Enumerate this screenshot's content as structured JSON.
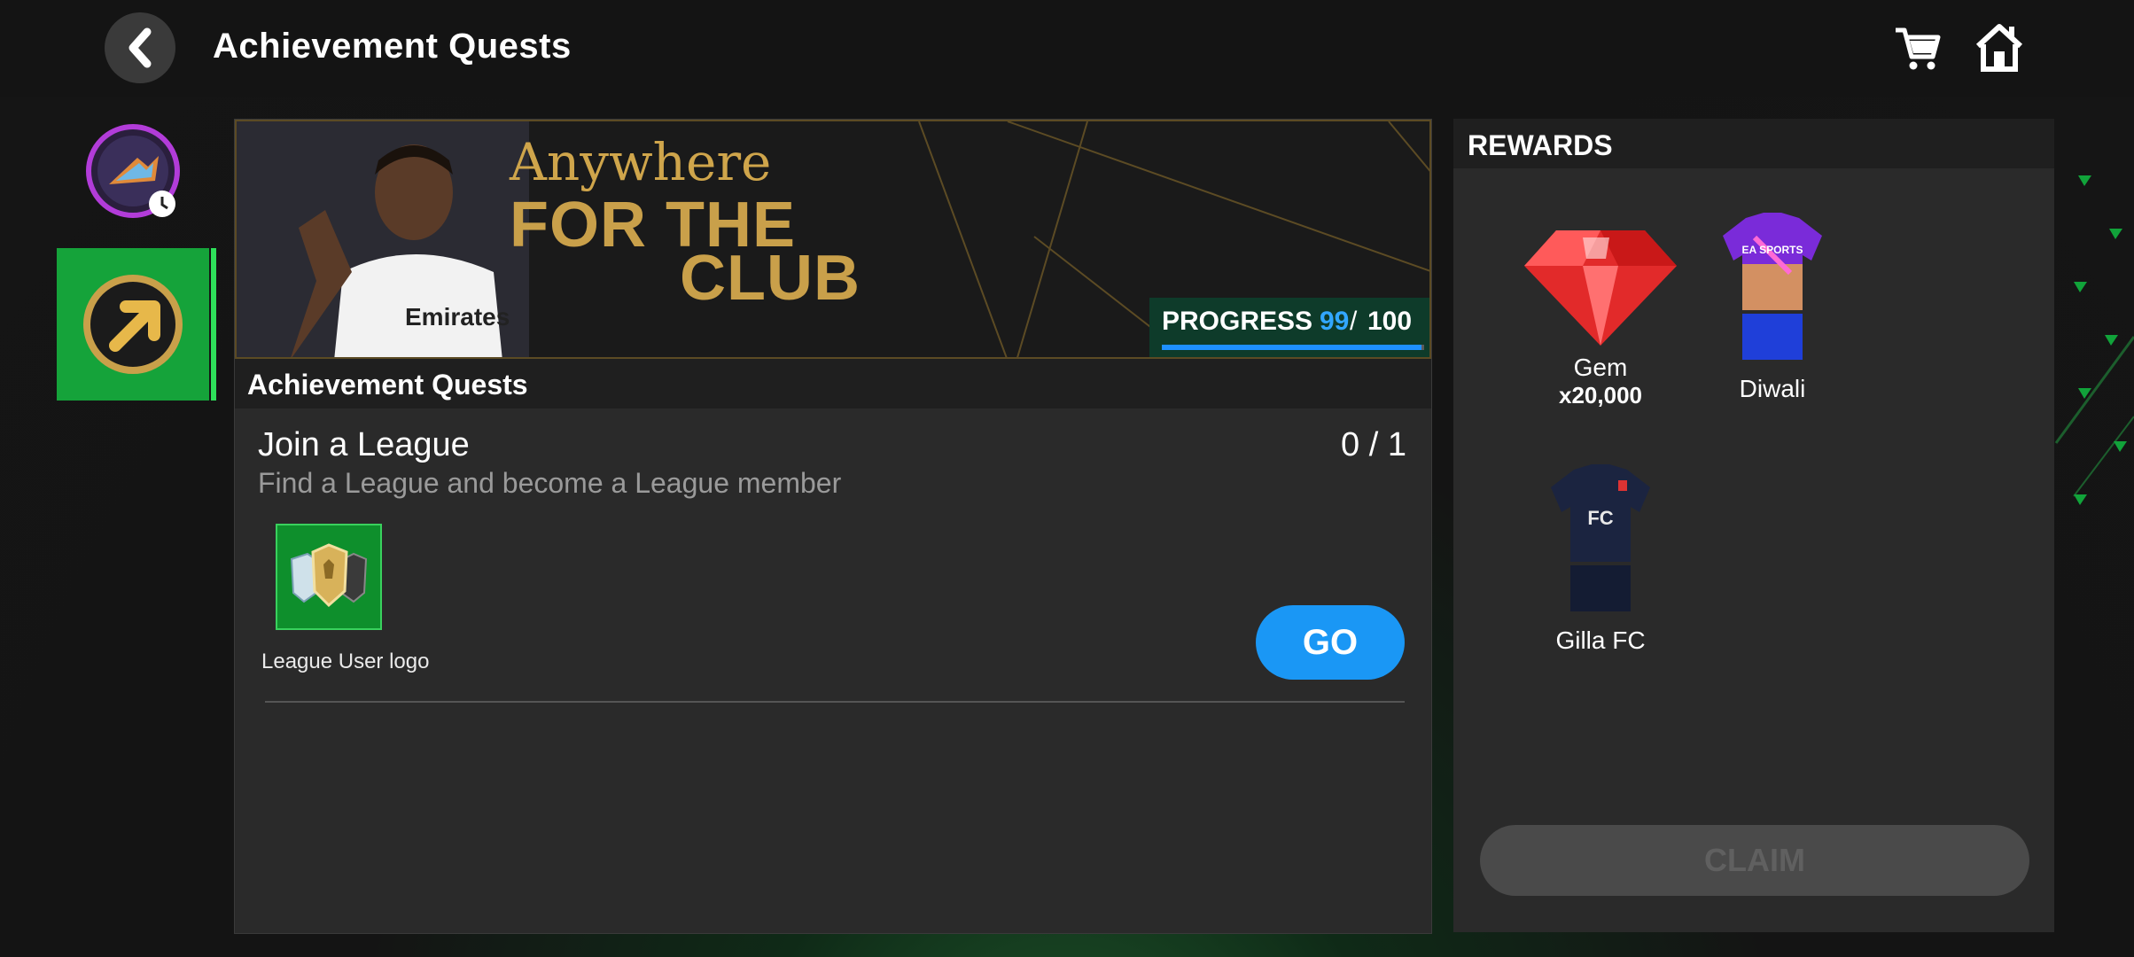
{
  "header": {
    "title": "Achievement Quests"
  },
  "banner": {
    "line1": "Anywhere",
    "line2": "FOR THE",
    "line3": "CLUB",
    "progress_label": "PROGRESS",
    "progress_value": "99",
    "progress_sep": "/",
    "progress_max": "100",
    "progress_fraction": 0.99
  },
  "quests": {
    "section_title": "Achievement Quests",
    "items": [
      {
        "title": "Join a League",
        "count": "0 / 1",
        "description": "Find a League and become a League member",
        "reward_label": "League User logo",
        "go_label": "GO"
      }
    ]
  },
  "rewards": {
    "title": "REWARDS",
    "items": [
      {
        "name": "Gem",
        "amount": "x20,000"
      },
      {
        "name": "Diwali",
        "amount": ""
      },
      {
        "name": "Gilla FC",
        "amount": ""
      }
    ],
    "claim_label": "CLAIM"
  },
  "colors": {
    "accent_blue": "#1a97f5",
    "rail_green": "#15a33a",
    "banner_gold": "#c9a04a",
    "progress_blue": "#32a7ff"
  },
  "icons": {
    "back": "chevron-left-icon",
    "cart": "cart-icon",
    "home": "home-icon"
  }
}
